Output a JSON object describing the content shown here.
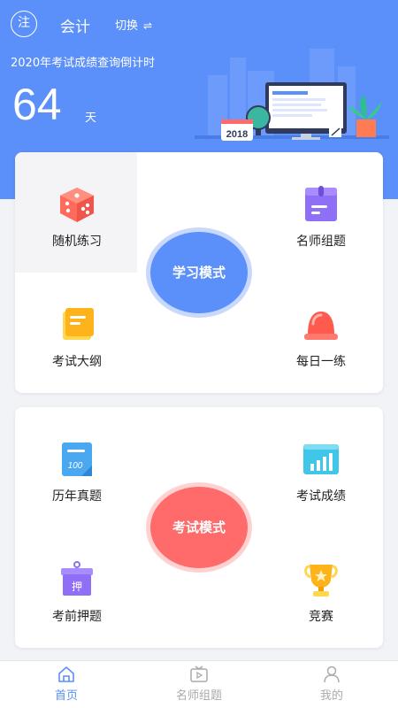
{
  "header": {
    "badge": "注",
    "subject": "会计",
    "switch_label": "切换",
    "switch_icon": "⇌",
    "countdown_title": "2020年考试成绩查询倒计时",
    "days": "64",
    "days_unit": "天",
    "illustration_year": "2018"
  },
  "study": {
    "mode_label": "学习模式",
    "items": [
      {
        "label": "随机练习",
        "icon": "dice-icon"
      },
      {
        "label": "名师组题",
        "icon": "purple-box-icon"
      },
      {
        "label": "考试大纲",
        "icon": "folder-icon"
      },
      {
        "label": "每日一练",
        "icon": "alarm-bell-icon"
      }
    ]
  },
  "exam": {
    "mode_label": "考试模式",
    "items": [
      {
        "label": "历年真题",
        "icon": "score-sheet-icon"
      },
      {
        "label": "考试成绩",
        "icon": "bar-chart-icon"
      },
      {
        "label": "考前押题",
        "icon": "stamp-box-icon"
      },
      {
        "label": "竞赛",
        "icon": "trophy-icon"
      }
    ]
  },
  "tabs": [
    {
      "label": "首页",
      "icon": "home-icon",
      "active": true
    },
    {
      "label": "名师组题",
      "icon": "tv-play-icon",
      "active": false
    },
    {
      "label": "我的",
      "icon": "user-icon",
      "active": false
    }
  ],
  "colors": {
    "primary": "#5b8ff9",
    "exam": "#ff6b6b"
  }
}
